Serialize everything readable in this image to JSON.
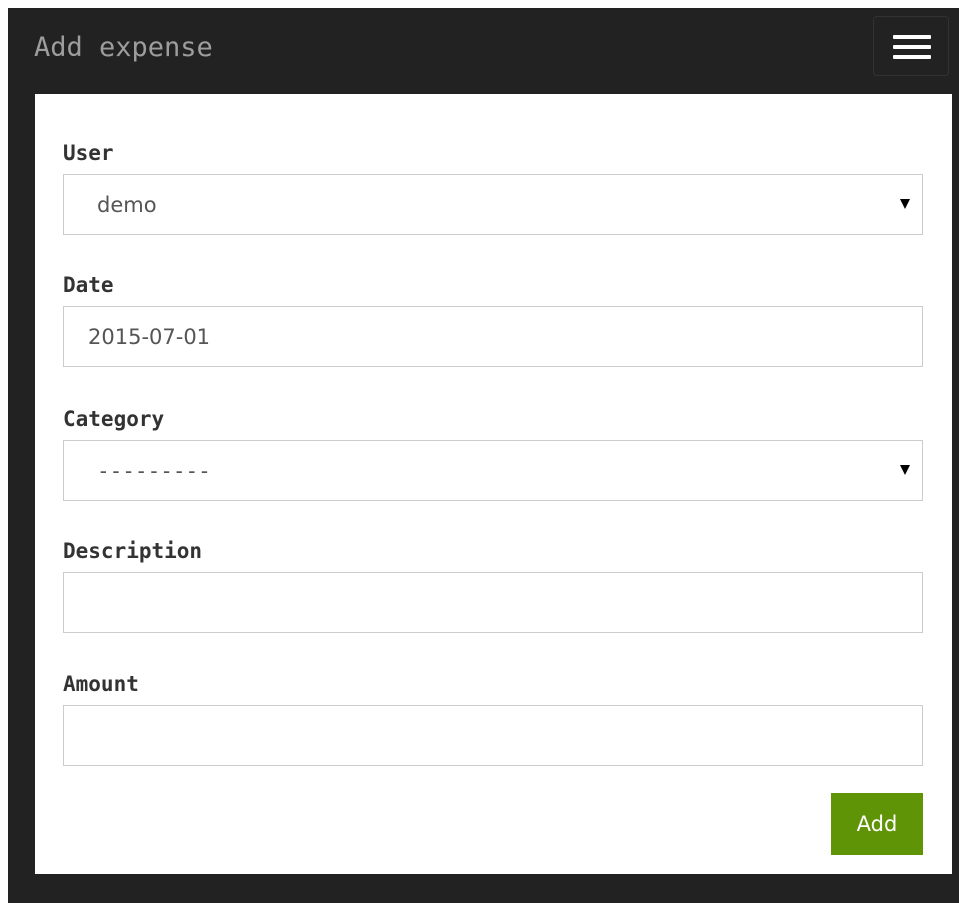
{
  "navbar": {
    "title": "Add expense",
    "menu_icon": "hamburger-menu-icon"
  },
  "form": {
    "user": {
      "label": "User",
      "selected": "demo"
    },
    "date": {
      "label": "Date",
      "value": "2015-07-01"
    },
    "category": {
      "label": "Category",
      "selected": "---------"
    },
    "description": {
      "label": "Description",
      "value": ""
    },
    "amount": {
      "label": "Amount",
      "value": ""
    },
    "submit_label": "Add"
  },
  "colors": {
    "navbar_bg": "#222222",
    "panel_bg": "#ffffff",
    "button_bg": "#5f9407",
    "title_text": "#9d9d9d"
  }
}
